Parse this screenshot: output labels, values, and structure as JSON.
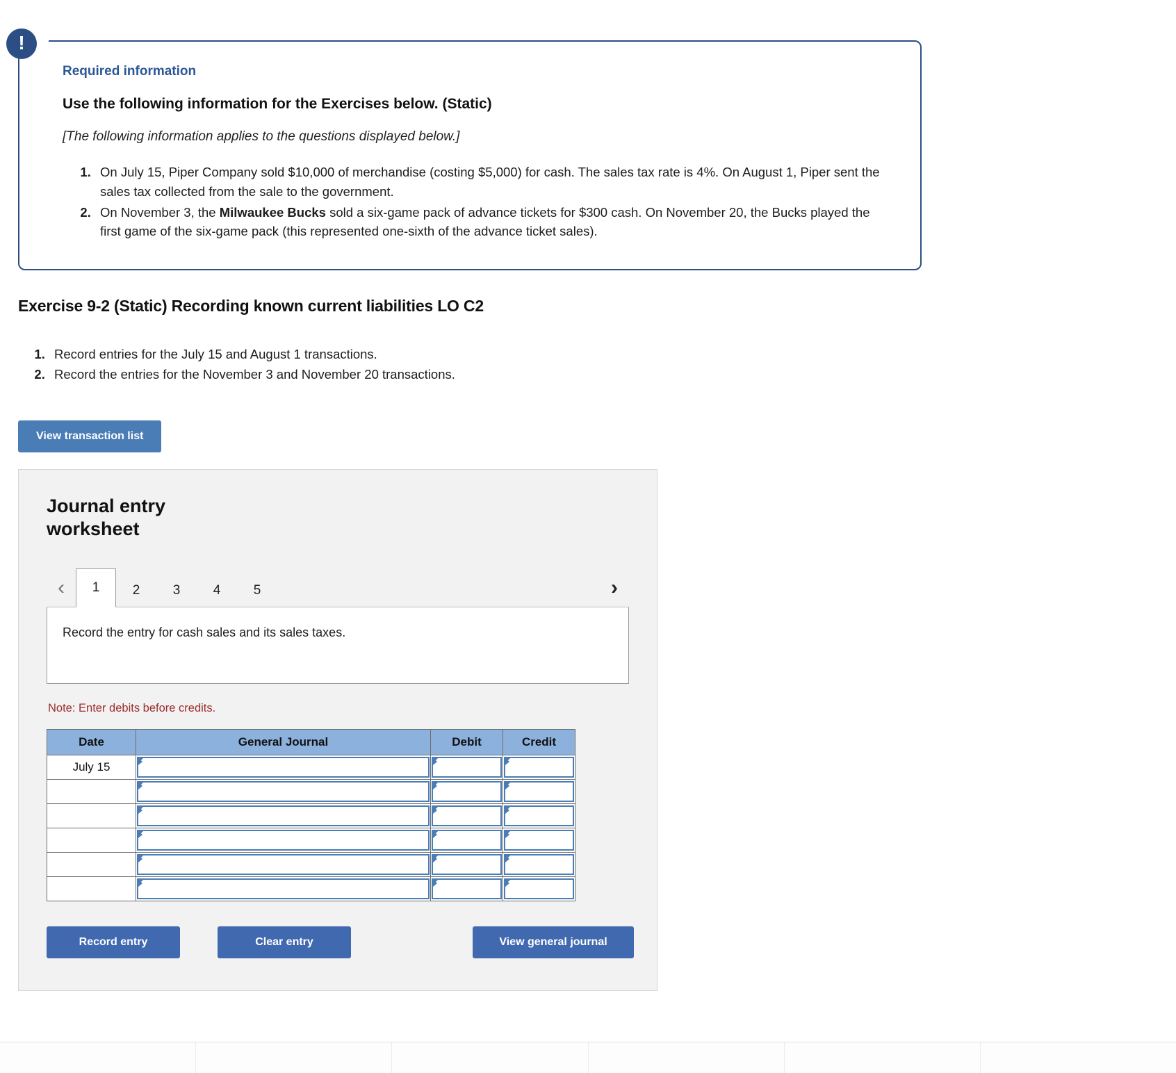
{
  "alert": {
    "icon": "exclamation-icon",
    "label": "Required information",
    "heading": "Use the following information for the Exercises below. (Static)",
    "subheading": "[The following information applies to the questions displayed below.]",
    "items": [
      {
        "part1": "On July 15, Piper Company sold $10,000 of merchandise (costing $5,000) for cash. The sales tax rate is 4%. On August 1, Piper sent the sales tax collected from the sale to the government."
      },
      {
        "part1": "On November 3, the ",
        "bold": "Milwaukee Bucks",
        "part2": " sold a six-game pack of advance tickets for $300 cash. On November 20, the Bucks played the first game of the six-game pack (this represented one-sixth of the advance ticket sales)."
      }
    ]
  },
  "exercise": {
    "title": "Exercise 9-2 (Static) Recording known current liabilities LO C2",
    "requirements": [
      "Record entries for the July 15 and August 1 transactions.",
      "Record the entries for the November 3 and November 20 transactions."
    ]
  },
  "buttons": {
    "view_transaction_list": "View transaction list",
    "record_entry": "Record entry",
    "clear_entry": "Clear entry",
    "view_general_journal": "View general journal"
  },
  "worksheet": {
    "title": "Journal entry worksheet",
    "prev_arrow": "‹",
    "next_arrow": "›",
    "tabs": [
      "1",
      "2",
      "3",
      "4",
      "5"
    ],
    "active_tab": "1",
    "prompt": "Record the entry for cash sales and its sales taxes.",
    "note": "Note: Enter debits before credits.",
    "table": {
      "columns": [
        "Date",
        "General Journal",
        "Debit",
        "Credit"
      ],
      "rows": [
        {
          "date": "July 15",
          "general_journal": "",
          "debit": "",
          "credit": ""
        },
        {
          "date": "",
          "general_journal": "",
          "debit": "",
          "credit": ""
        },
        {
          "date": "",
          "general_journal": "",
          "debit": "",
          "credit": ""
        },
        {
          "date": "",
          "general_journal": "",
          "debit": "",
          "credit": ""
        },
        {
          "date": "",
          "general_journal": "",
          "debit": "",
          "credit": ""
        },
        {
          "date": "",
          "general_journal": "",
          "debit": "",
          "credit": ""
        }
      ]
    }
  },
  "colors": {
    "alert_border": "#2b4f85",
    "alert_title": "#2b5797",
    "primary_button": "#4169b0",
    "secondary_button": "#4a7cb5",
    "table_header": "#8cb1dd",
    "note_text": "#9c2d2d",
    "panel_bg": "#f2f2f2"
  }
}
